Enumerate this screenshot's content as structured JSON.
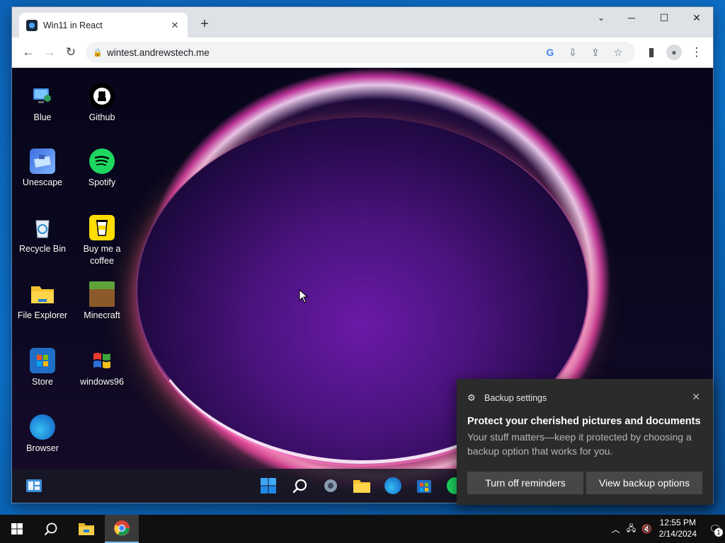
{
  "browser": {
    "tab_title": "Win11 in React",
    "url": "wintest.andrewstech.me"
  },
  "desktop_icons": [
    {
      "label": "Blue"
    },
    {
      "label": "Github"
    },
    {
      "label": "Unescape"
    },
    {
      "label": "Spotify"
    },
    {
      "label": "Recycle Bin"
    },
    {
      "label": "Buy me a coffee"
    },
    {
      "label": "File Explorer"
    },
    {
      "label": "Minecraft"
    },
    {
      "label": "Store"
    },
    {
      "label": "windows96"
    },
    {
      "label": "Browser"
    }
  ],
  "toast": {
    "app": "Backup settings",
    "title": "Protect your cherished pictures and documents",
    "body": "Your stuff matters—keep it protected by choosing a backup option that works for you.",
    "btn_turn_off": "Turn off reminders",
    "btn_view": "View backup options"
  },
  "host_taskbar": {
    "time": "12:55 PM",
    "date": "2/14/2024",
    "notification_count": "1"
  }
}
